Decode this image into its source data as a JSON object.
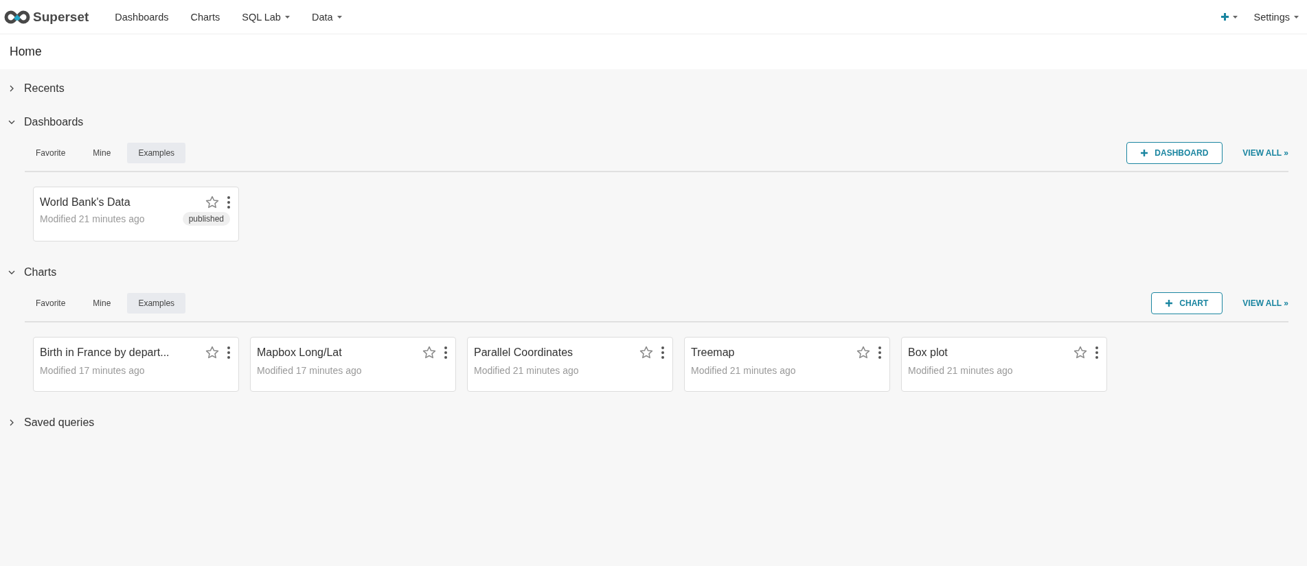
{
  "navbar": {
    "brand": "Superset",
    "menu": [
      {
        "label": "Dashboards",
        "dropdown": false
      },
      {
        "label": "Charts",
        "dropdown": false
      },
      {
        "label": "SQL Lab",
        "dropdown": true
      },
      {
        "label": "Data",
        "dropdown": true
      }
    ],
    "right_menu": [
      {
        "kind": "plus",
        "dropdown": true
      },
      {
        "kind": "text",
        "label": "Settings",
        "dropdown": true
      }
    ]
  },
  "page_title": "Home",
  "sections": [
    {
      "title": "Recents",
      "expanded": false
    },
    {
      "title": "Dashboards",
      "expanded": true,
      "tabs": [
        {
          "label": "Favorite",
          "selected": false
        },
        {
          "label": "Mine",
          "selected": false
        },
        {
          "label": "Examples",
          "selected": true
        }
      ],
      "create_button": "DASHBOARD",
      "view_all": "VIEW ALL »",
      "cards": [
        {
          "title": "World Bank's Data",
          "modified": "Modified 21 minutes ago",
          "starred": false,
          "status": "published"
        }
      ]
    },
    {
      "title": "Charts",
      "expanded": true,
      "tabs": [
        {
          "label": "Favorite",
          "selected": false
        },
        {
          "label": "Mine",
          "selected": false
        },
        {
          "label": "Examples",
          "selected": true
        }
      ],
      "create_button": "CHART",
      "view_all": "VIEW ALL »",
      "cards": [
        {
          "title": "Birth in France by depart...",
          "modified": "Modified 17 minutes ago",
          "starred": false
        },
        {
          "title": "Mapbox Long/Lat",
          "modified": "Modified 17 minutes ago",
          "starred": false
        },
        {
          "title": "Parallel Coordinates",
          "modified": "Modified 21 minutes ago",
          "starred": false
        },
        {
          "title": "Treemap",
          "modified": "Modified 21 minutes ago",
          "starred": false
        },
        {
          "title": "Box plot",
          "modified": "Modified 21 minutes ago",
          "starred": false
        }
      ]
    },
    {
      "title": "Saved queries",
      "expanded": false
    }
  ]
}
